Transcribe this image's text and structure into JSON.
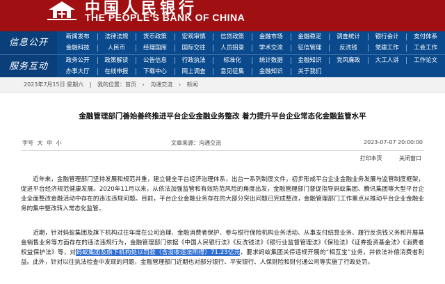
{
  "header": {
    "cn_name": "中国人民银行",
    "en_name": "THE PEOPLE'S BANK OF CHINA",
    "brand_color": "#a01012"
  },
  "nav": {
    "section1_label": "信息公开",
    "section2_label": "服务互动",
    "row1_items": [
      "新闻发布",
      "法律法规",
      "货币政策",
      "宏观审慎",
      "信贷政策",
      "金融市场",
      "金融稳定",
      "调查统计",
      "银行会计",
      "支付体系",
      "金融科技",
      "人民币",
      "经理国库",
      "国际交往",
      "人员招录",
      "学术交流",
      "征信管理",
      "反洗钱",
      "党建工作",
      "工会工作"
    ],
    "row2_items": [
      "政务公开",
      "政策解读",
      "公告信息",
      "行政执法",
      "标准化",
      "统计数据",
      "金融知识",
      "党风廉政",
      "大工人讲",
      "工作论文",
      "办事大厅",
      "在线申报",
      "下载中心",
      "网上调查",
      "意见征集",
      "金融知识",
      "关于我们",
      "",
      "",
      ""
    ],
    "accent_color": "#0a4a8c"
  },
  "breadcrumb": {
    "date": "2023年7月15日 星期六",
    "sep": "|",
    "items": [
      "我的位置：首页",
      "沟通交流",
      "新闻"
    ]
  },
  "article": {
    "title": "金融管理部门善始善终推进平台企业金融业务整改 着力提升平台企业常态化金融监管水平",
    "font_label": "字号",
    "font_sizes": [
      "大",
      "中",
      "小"
    ],
    "source": "文章来源：沟通交流",
    "date": "2023-07-07 20:00:00",
    "print": "打印本页",
    "close": "关闭窗口",
    "p1": "近年来，金融管理部门坚持发展和规范并重，建立健全平台经济治理体系，出台一系列制度文件，初步形成平台企业金融业务发展与监管制度框架，促进平台经济规范健康发展。2020年11月以来，从依法加强监管和有效防范风险的角度出发，金融管理部门督促指导蚂蚁集团、腾讯集团等大型平台企业全面整改金融活动中存在的违法违规问题。目前，平台企业金融业务存在的大部分突出问题已完成整改，金融管理部门工作重点从推动平台企业金融业务的集中整改转入常态化监管。",
    "p2_before": "近期，针对蚂蚁集团及旗下机构过往年度在公司治理、金融消费者保护、参与银行保险机构业务活动、从事支付结算业务、履行反洗钱义务和开展基金销售业务等方面存在的违法违规行为，金融管理部门依据《中国人民银行法》《反洗钱法》《银行业监督管理法》《保险法》《证券投资基金法》《消费者权益保护法》等，对",
    "p2_highlight": "蚂蚁集团及旗下机构处以罚款（含没收违法所得）71.23亿元",
    "p2_after": "，要求蚂蚁集团关停违规开展的“相互宝”业务，并依法补偿消费者利益。此外，针对以往执法检查中发现的问题，金融管理部门近期也对部分银行、平安银行、人保财险和财付通公司等实施了行政处罚。"
  }
}
